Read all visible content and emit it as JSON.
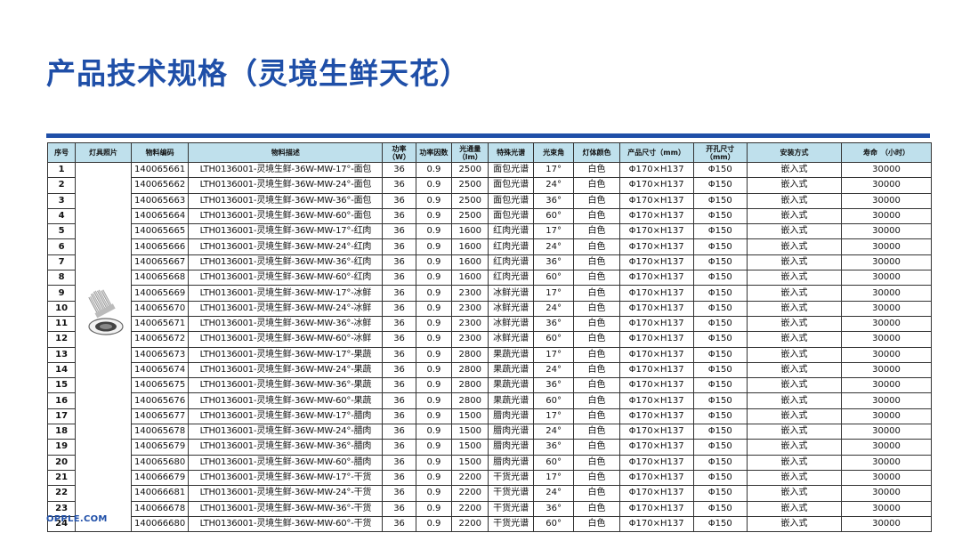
{
  "page": {
    "title": "产品技术规格（灵境生鲜天花）",
    "logo_text": "OPPLE.COM"
  },
  "table": {
    "headers": [
      "序号",
      "灯具照片",
      "物料编码",
      "物料描述",
      "功率（W）",
      "功率因数",
      "光通量（lm）",
      "特殊光谱",
      "光束角",
      "灯体颜色",
      "产品尺寸（mm）",
      "开孔尺寸（mm）",
      "安装方式",
      "寿命　（小时）"
    ],
    "rows": [
      {
        "seq": "1",
        "code": "140065661",
        "desc": "LTH0136001-灵境生鲜-36W-MW-17°-面包",
        "power": "36",
        "pf": "0.9",
        "lumen": "2500",
        "spectrum": "面包光谱",
        "beam": "17°",
        "color": "白色",
        "size": "Φ170×H137",
        "cutout": "Φ150",
        "install": "嵌入式",
        "life": "30000"
      },
      {
        "seq": "2",
        "code": "140065662",
        "desc": "LTH0136001-灵境生鲜-36W-MW-24°-面包",
        "power": "36",
        "pf": "0.9",
        "lumen": "2500",
        "spectrum": "面包光谱",
        "beam": "24°",
        "color": "白色",
        "size": "Φ170×H137",
        "cutout": "Φ150",
        "install": "嵌入式",
        "life": "30000"
      },
      {
        "seq": "3",
        "code": "140065663",
        "desc": "LTH0136001-灵境生鲜-36W-MW-36°-面包",
        "power": "36",
        "pf": "0.9",
        "lumen": "2500",
        "spectrum": "面包光谱",
        "beam": "36°",
        "color": "白色",
        "size": "Φ170×H137",
        "cutout": "Φ150",
        "install": "嵌入式",
        "life": "30000"
      },
      {
        "seq": "4",
        "code": "140065664",
        "desc": "LTH0136001-灵境生鲜-36W-MW-60°-面包",
        "power": "36",
        "pf": "0.9",
        "lumen": "2500",
        "spectrum": "面包光谱",
        "beam": "60°",
        "color": "白色",
        "size": "Φ170×H137",
        "cutout": "Φ150",
        "install": "嵌入式",
        "life": "30000"
      },
      {
        "seq": "5",
        "code": "140065665",
        "desc": "LTH0136001-灵境生鲜-36W-MW-17°-红肉",
        "power": "36",
        "pf": "0.9",
        "lumen": "1600",
        "spectrum": "红肉光谱",
        "beam": "17°",
        "color": "白色",
        "size": "Φ170×H137",
        "cutout": "Φ150",
        "install": "嵌入式",
        "life": "30000"
      },
      {
        "seq": "6",
        "code": "140065666",
        "desc": "LTH0136001-灵境生鲜-36W-MW-24°-红肉",
        "power": "36",
        "pf": "0.9",
        "lumen": "1600",
        "spectrum": "红肉光谱",
        "beam": "24°",
        "color": "白色",
        "size": "Φ170×H137",
        "cutout": "Φ150",
        "install": "嵌入式",
        "life": "30000"
      },
      {
        "seq": "7",
        "code": "140065667",
        "desc": "LTH0136001-灵境生鲜-36W-MW-36°-红肉",
        "power": "36",
        "pf": "0.9",
        "lumen": "1600",
        "spectrum": "红肉光谱",
        "beam": "36°",
        "color": "白色",
        "size": "Φ170×H137",
        "cutout": "Φ150",
        "install": "嵌入式",
        "life": "30000"
      },
      {
        "seq": "8",
        "code": "140065668",
        "desc": "LTH0136001-灵境生鲜-36W-MW-60°-红肉",
        "power": "36",
        "pf": "0.9",
        "lumen": "1600",
        "spectrum": "红肉光谱",
        "beam": "60°",
        "color": "白色",
        "size": "Φ170×H137",
        "cutout": "Φ150",
        "install": "嵌入式",
        "life": "30000"
      },
      {
        "seq": "9",
        "code": "140065669",
        "desc": "LTH0136001-灵境生鲜-36W-MW-17°-冰鲜",
        "power": "36",
        "pf": "0.9",
        "lumen": "2300",
        "spectrum": "冰鲜光谱",
        "beam": "17°",
        "color": "白色",
        "size": "Φ170×H137",
        "cutout": "Φ150",
        "install": "嵌入式",
        "life": "30000"
      },
      {
        "seq": "10",
        "code": "140065670",
        "desc": "LTH0136001-灵境生鲜-36W-MW-24°-冰鲜",
        "power": "36",
        "pf": "0.9",
        "lumen": "2300",
        "spectrum": "冰鲜光谱",
        "beam": "24°",
        "color": "白色",
        "size": "Φ170×H137",
        "cutout": "Φ150",
        "install": "嵌入式",
        "life": "30000"
      },
      {
        "seq": "11",
        "code": "140065671",
        "desc": "LTH0136001-灵境生鲜-36W-MW-36°-冰鲜",
        "power": "36",
        "pf": "0.9",
        "lumen": "2300",
        "spectrum": "冰鲜光谱",
        "beam": "36°",
        "color": "白色",
        "size": "Φ170×H137",
        "cutout": "Φ150",
        "install": "嵌入式",
        "life": "30000"
      },
      {
        "seq": "12",
        "code": "140065672",
        "desc": "LTH0136001-灵境生鲜-36W-MW-60°-冰鲜",
        "power": "36",
        "pf": "0.9",
        "lumen": "2300",
        "spectrum": "冰鲜光谱",
        "beam": "60°",
        "color": "白色",
        "size": "Φ170×H137",
        "cutout": "Φ150",
        "install": "嵌入式",
        "life": "30000"
      },
      {
        "seq": "13",
        "code": "140065673",
        "desc": "LTH0136001-灵境生鲜-36W-MW-17°-果蔬",
        "power": "36",
        "pf": "0.9",
        "lumen": "2800",
        "spectrum": "果蔬光谱",
        "beam": "17°",
        "color": "白色",
        "size": "Φ170×H137",
        "cutout": "Φ150",
        "install": "嵌入式",
        "life": "30000"
      },
      {
        "seq": "14",
        "code": "140065674",
        "desc": "LTH0136001-灵境生鲜-36W-MW-24°-果蔬",
        "power": "36",
        "pf": "0.9",
        "lumen": "2800",
        "spectrum": "果蔬光谱",
        "beam": "24°",
        "color": "白色",
        "size": "Φ170×H137",
        "cutout": "Φ150",
        "install": "嵌入式",
        "life": "30000"
      },
      {
        "seq": "15",
        "code": "140065675",
        "desc": "LTH0136001-灵境生鲜-36W-MW-36°-果蔬",
        "power": "36",
        "pf": "0.9",
        "lumen": "2800",
        "spectrum": "果蔬光谱",
        "beam": "36°",
        "color": "白色",
        "size": "Φ170×H137",
        "cutout": "Φ150",
        "install": "嵌入式",
        "life": "30000"
      },
      {
        "seq": "16",
        "code": "140065676",
        "desc": "LTH0136001-灵境生鲜-36W-MW-60°-果蔬",
        "power": "36",
        "pf": "0.9",
        "lumen": "2800",
        "spectrum": "果蔬光谱",
        "beam": "60°",
        "color": "白色",
        "size": "Φ170×H137",
        "cutout": "Φ150",
        "install": "嵌入式",
        "life": "30000"
      },
      {
        "seq": "17",
        "code": "140065677",
        "desc": "LTH0136001-灵境生鲜-36W-MW-17°-腊肉",
        "power": "36",
        "pf": "0.9",
        "lumen": "1500",
        "spectrum": "腊肉光谱",
        "beam": "17°",
        "color": "白色",
        "size": "Φ170×H137",
        "cutout": "Φ150",
        "install": "嵌入式",
        "life": "30000"
      },
      {
        "seq": "18",
        "code": "140065678",
        "desc": "LTH0136001-灵境生鲜-36W-MW-24°-腊肉",
        "power": "36",
        "pf": "0.9",
        "lumen": "1500",
        "spectrum": "腊肉光谱",
        "beam": "24°",
        "color": "白色",
        "size": "Φ170×H137",
        "cutout": "Φ150",
        "install": "嵌入式",
        "life": "30000"
      },
      {
        "seq": "19",
        "code": "140065679",
        "desc": "LTH0136001-灵境生鲜-36W-MW-36°-腊肉",
        "power": "36",
        "pf": "0.9",
        "lumen": "1500",
        "spectrum": "腊肉光谱",
        "beam": "36°",
        "color": "白色",
        "size": "Φ170×H137",
        "cutout": "Φ150",
        "install": "嵌入式",
        "life": "30000"
      },
      {
        "seq": "20",
        "code": "140065680",
        "desc": "LTH0136001-灵境生鲜-36W-MW-60°-腊肉",
        "power": "36",
        "pf": "0.9",
        "lumen": "1500",
        "spectrum": "腊肉光谱",
        "beam": "60°",
        "color": "白色",
        "size": "Φ170×H137",
        "cutout": "Φ150",
        "install": "嵌入式",
        "life": "30000"
      },
      {
        "seq": "21",
        "code": "140066679",
        "desc": "LTH0136001-灵境生鲜-36W-MW-17°-干货",
        "power": "36",
        "pf": "0.9",
        "lumen": "2200",
        "spectrum": "干货光谱",
        "beam": "17°",
        "color": "白色",
        "size": "Φ170×H137",
        "cutout": "Φ150",
        "install": "嵌入式",
        "life": "30000"
      },
      {
        "seq": "22",
        "code": "140066681",
        "desc": "LTH0136001-灵境生鲜-36W-MW-24°-干货",
        "power": "36",
        "pf": "0.9",
        "lumen": "2200",
        "spectrum": "干货光谱",
        "beam": "24°",
        "color": "白色",
        "size": "Φ170×H137",
        "cutout": "Φ150",
        "install": "嵌入式",
        "life": "30000"
      },
      {
        "seq": "23",
        "code": "140066678",
        "desc": "LTH0136001-灵境生鲜-36W-MW-36°-干货",
        "power": "36",
        "pf": "0.9",
        "lumen": "2200",
        "spectrum": "干货光谱",
        "beam": "36°",
        "color": "白色",
        "size": "Φ170×H137",
        "cutout": "Φ150",
        "install": "嵌入式",
        "life": "30000"
      },
      {
        "seq": "24",
        "code": "140066680",
        "desc": "LTH0136001-灵境生鲜-36W-MW-60°-干货",
        "power": "36",
        "pf": "0.9",
        "lumen": "2200",
        "spectrum": "干货光谱",
        "beam": "60°",
        "color": "白色",
        "size": "Φ170×H137",
        "cutout": "Φ150",
        "install": "嵌入式",
        "life": "30000"
      }
    ]
  },
  "colors": {
    "title": "#1f4fa8",
    "header_bg": "#bfe0ec",
    "rule": "#1f4fa8"
  },
  "icons": {
    "product_photo": "downlight-lamp-icon"
  }
}
